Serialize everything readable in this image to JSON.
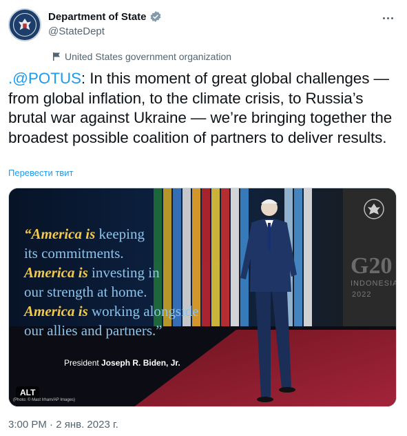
{
  "author": {
    "display_name": "Department of State",
    "handle": "@StateDept",
    "affiliation": "United States government organization",
    "avatar_icon": "state-department-seal-icon",
    "verified_icon": "verified-badge-icon",
    "affiliation_icon": "flag-icon"
  },
  "menu": {
    "more_icon": "more-dots-icon"
  },
  "tweet": {
    "mention": ".@POTUS",
    "text_after_mention": ": In this moment of great global challenges — from global inflation, to the climate crisis, to Russia’s brutal war against Ukraine — we’re bringing together the broadest possible coalition of partners to deliver results.",
    "translate_link": "Перевести твит"
  },
  "media": {
    "quote_lines": [
      {
        "bold": "“America is",
        "rest": " keeping"
      },
      {
        "bold": "",
        "rest": "its commitments."
      },
      {
        "bold": "America is",
        "rest": " investing in"
      },
      {
        "bold": "",
        "rest": "our strength at home."
      },
      {
        "bold": "America is",
        "rest": " working alongside"
      },
      {
        "bold": "",
        "rest": "our allies and partners.”"
      }
    ],
    "attribution_prefix": "President",
    "attribution_name": "Joseph R. Biden, Jr.",
    "alt_badge": "ALT",
    "photo_credit": "(Photo: © Mast Irham/AP Images)",
    "backdrop_text": "G20",
    "backdrop_sub": "INDONESIA",
    "backdrop_year": "2022",
    "colors": {
      "background": "#0a1a33",
      "quote_text": "#8bc4ec",
      "quote_emphasis": "#f2c94c",
      "carpet": "#8a1c2b"
    }
  },
  "timestamp": "3:00 PM · 2 янв. 2023 г."
}
